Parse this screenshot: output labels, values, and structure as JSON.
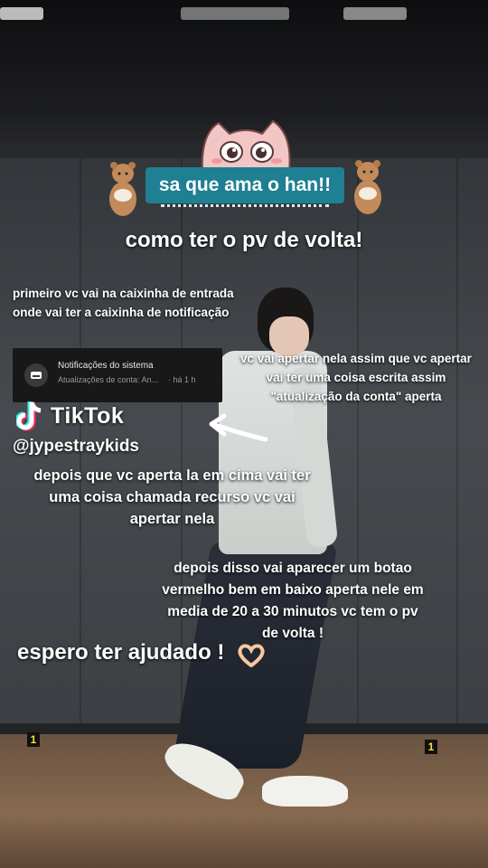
{
  "badge": {
    "label": "sa que ama o han!!"
  },
  "title": "como ter o pv de volta!",
  "step1": {
    "line1": "primeiro vc vai na caixinha de entrada",
    "line2": "onde vai ter a caixinha de notificação"
  },
  "notification": {
    "title": "Notificações do sistema",
    "subtitle": "Atualizações de conta: An...",
    "time": "· há 1 h",
    "icon": "inbox-icon"
  },
  "step2": {
    "line1": "vc vai apertar nela assim que vc apertar",
    "line2": "vai ter uma coisa escrita assim",
    "line3": "\"atualização da conta\" aperta"
  },
  "watermark": {
    "brand": "TikTok",
    "handle": "@jypestraykids",
    "logo": "tiktok-logo-icon"
  },
  "step3": {
    "line1": "depois que vc aperta la em cima vai ter",
    "line2": "uma coisa chamada recurso vc vai",
    "line3": "apertar nela"
  },
  "step4": {
    "line1": "depois disso vai aparecer um botao",
    "line2": "vermelho bem em baixo aperta nele em",
    "line3": "media de 20 a 30 minutos vc tem o pv",
    "line4": "de volta !"
  },
  "closing": {
    "text": "espero ter ajudado !"
  },
  "floor_markers": [
    "1",
    "1"
  ],
  "colors": {
    "badge": "#1f7f93",
    "text": "#ffffff",
    "notification_bg": "#181818"
  }
}
